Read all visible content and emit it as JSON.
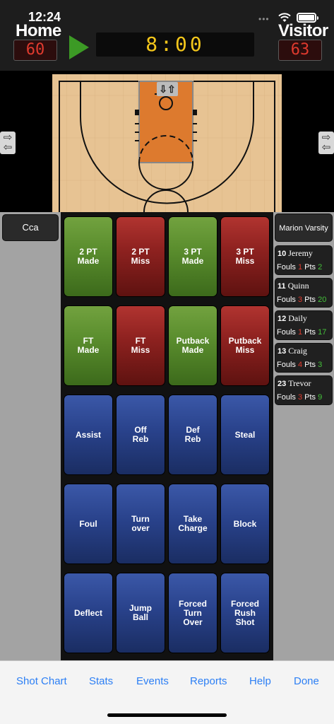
{
  "status_bar": {
    "time": "12:24",
    "dots": "•••"
  },
  "scoreboard": {
    "home_label": "Home",
    "home_score": "60",
    "visitor_label": "Visitor",
    "visitor_score": "63",
    "clock": "8:00",
    "play_icon": "play-icon"
  },
  "court": {
    "swap_icon": "swap-arrows-icon",
    "left_arrow_icon": "swap-arrows-icon",
    "right_arrow_icon": "swap-arrows-icon"
  },
  "left_panel": {
    "team_button": "Cca"
  },
  "stat_buttons": [
    {
      "label": "2 PT\nMade",
      "color": "green"
    },
    {
      "label": "2 PT\nMiss",
      "color": "red"
    },
    {
      "label": "3 PT\nMade",
      "color": "green"
    },
    {
      "label": "3 PT\nMiss",
      "color": "red"
    },
    {
      "label": "FT\nMade",
      "color": "green"
    },
    {
      "label": "FT\nMiss",
      "color": "red"
    },
    {
      "label": "Putback\nMade",
      "color": "green"
    },
    {
      "label": "Putback\nMiss",
      "color": "red"
    },
    {
      "label": "Assist",
      "color": "blue"
    },
    {
      "label": "Off\nReb",
      "color": "blue"
    },
    {
      "label": "Def\nReb",
      "color": "blue"
    },
    {
      "label": "Steal",
      "color": "blue"
    },
    {
      "label": "Foul",
      "color": "blue"
    },
    {
      "label": "Turn\nover",
      "color": "blue"
    },
    {
      "label": "Take\nCharge",
      "color": "blue"
    },
    {
      "label": "Block",
      "color": "blue"
    },
    {
      "label": "Deflect",
      "color": "blue"
    },
    {
      "label": "Jump\nBall",
      "color": "blue"
    },
    {
      "label": "Forced\nTurn\nOver",
      "color": "blue"
    },
    {
      "label": "Forced\nRush\nShot",
      "color": "blue"
    }
  ],
  "right_panel": {
    "team_button": "Marion Varsity",
    "fouls_label": "Fouls",
    "pts_label": "Pts",
    "players": [
      {
        "number": "10",
        "name": "Jeremy",
        "fouls": "1",
        "pts": "2"
      },
      {
        "number": "11",
        "name": "Quinn",
        "fouls": "3",
        "pts": "20"
      },
      {
        "number": "12",
        "name": "Daily",
        "fouls": "1",
        "pts": "17"
      },
      {
        "number": "13",
        "name": "Craig",
        "fouls": "4",
        "pts": "3"
      },
      {
        "number": "23",
        "name": "Trevor",
        "fouls": "3",
        "pts": "9"
      }
    ]
  },
  "toolbar": {
    "shot_chart": "Shot Chart",
    "stats": "Stats",
    "events": "Events",
    "reports": "Reports",
    "help": "Help",
    "done": "Done"
  },
  "colors": {
    "home_score": "#e03a2e",
    "clock": "#f3c61b",
    "play": "#3c9a25",
    "green_button": "#5b8e2e",
    "red_button": "#8f2220",
    "blue_button": "#29428b",
    "toolbar_link": "#2c7ff5"
  }
}
